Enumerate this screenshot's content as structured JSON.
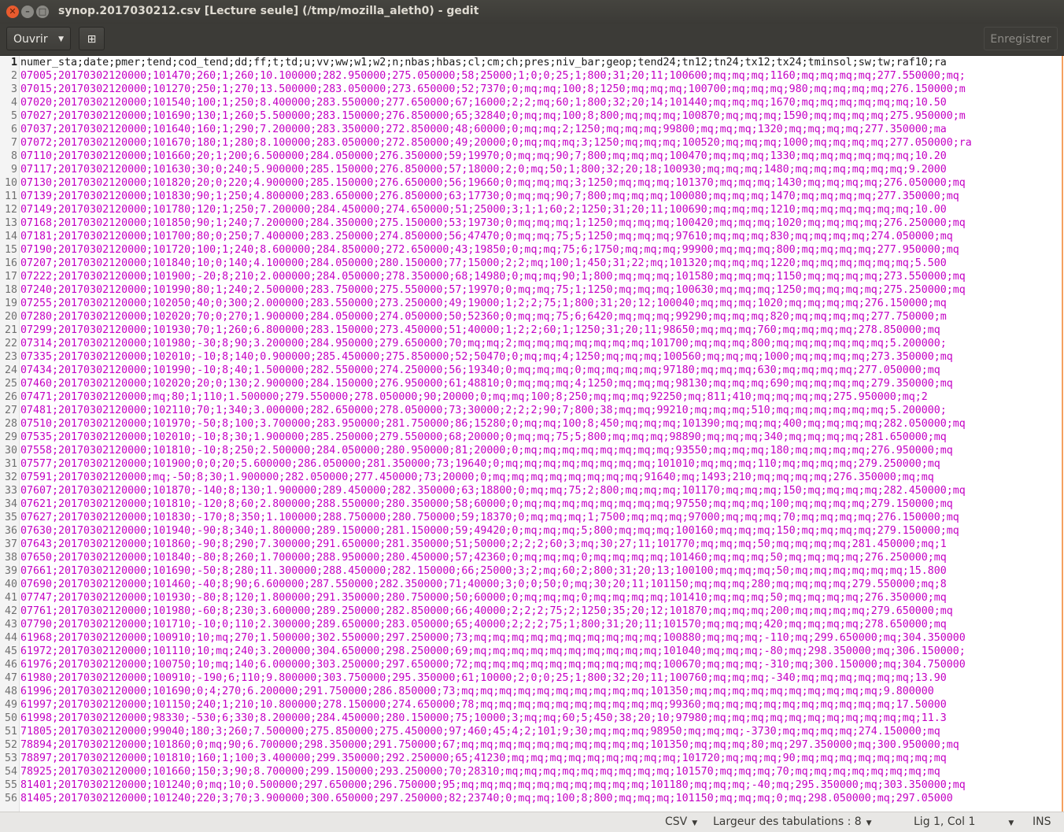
{
  "window": {
    "title": "synop.2017030212.csv [Lecture seule] (/tmp/mozilla_aleth0) - gedit",
    "close_glyph": "✕",
    "min_glyph": "–",
    "max_glyph": "□"
  },
  "toolbar": {
    "open_label": "Ouvrir",
    "new_tab_glyph": "⊞",
    "save_label": "Enregistrer"
  },
  "editor": {
    "lines": [
      "numer_sta;date;pmer;tend;cod_tend;dd;ff;t;td;u;vv;ww;w1;w2;n;nbas;hbas;cl;cm;ch;pres;niv_bar;geop;tend24;tn12;tn24;tx12;tx24;tminsol;sw;tw;raf10;ra",
      "07005;20170302120000;101470;260;1;260;10.100000;282.950000;275.050000;58;25000;1;0;0;25;1;800;31;20;11;100600;mq;mq;mq;1160;mq;mq;mq;mq;277.550000;mq;",
      "07015;20170302120000;101270;250;1;270;13.500000;283.050000;273.650000;52;7370;0;mq;mq;100;8;1250;mq;mq;mq;100700;mq;mq;mq;980;mq;mq;mq;mq;276.150000;m",
      "07020;20170302120000;101540;100;1;250;8.400000;283.550000;277.650000;67;16000;2;2;mq;60;1;800;32;20;14;101440;mq;mq;mq;1670;mq;mq;mq;mq;mq;mq;10.50",
      "07027;20170302120000;101690;130;1;260;5.500000;283.150000;276.850000;65;32840;0;mq;mq;100;8;800;mq;mq;mq;100870;mq;mq;mq;1590;mq;mq;mq;mq;275.950000;m",
      "07037;20170302120000;101640;160;1;290;7.200000;283.350000;272.850000;48;60000;0;mq;mq;2;1250;mq;mq;mq;99800;mq;mq;mq;1320;mq;mq;mq;mq;277.350000;ma",
      "07072;20170302120000;101670;180;1;280;8.100000;283.050000;272.850000;49;20000;0;mq;mq;mq;3;1250;mq;mq;mq;100520;mq;mq;mq;1000;mq;mq;mq;mq;277.050000;ra",
      "07110;20170302120000;101660;20;1;200;6.500000;284.050000;276.350000;59;19970;0;mq;mq;90;7;800;mq;mq;mq;100470;mq;mq;mq;1330;mq;mq;mq;mq;mq;mq;10.20",
      "07117;20170302120000;101630;30;0;240;5.900000;285.150000;276.850000;57;18000;2;0;mq;50;1;800;32;20;18;100930;mq;mq;mq;1480;mq;mq;mq;mq;mq;mq;9.2000",
      "07130;20170302120000;101820;20;0;220;4.900000;285.150000;276.650000;56;19660;0;mq;mq;mq;3;1250;mq;mq;mq;101370;mq;mq;mq;1430;mq;mq;mq;mq;276.050000;mq",
      "07139;20170302120000;101830;90;1;250;4.800000;283.650000;276.850000;63;17730;0;mq;mq;90;7;800;mq;mq;mq;100080;mq;mq;mq;1470;mq;mq;mq;mq;277.350000;mq",
      "07149;20170302120000;101780;120;1;250;7.200000;284.450000;274.650000;51;25000;3;1;1;60;2;1250;31;20;11;100690;mq;mq;mq;1210;mq;mq;mq;mq;mq;mq;10.00",
      "07168;20170302120000;101850;90;1;240;7.200000;284.350000;275.150000;53;19730;0;mq;mq;mq;1;1250;mq;mq;mq;100420;mq;mq;mq;1020;mq;mq;mq;mq;276.250000;mq",
      "07181;20170302120000;101700;80;0;250;7.400000;283.250000;274.850000;56;47470;0;mq;mq;75;5;1250;mq;mq;mq;97610;mq;mq;mq;830;mq;mq;mq;mq;274.050000;mq",
      "07190;20170302120000;101720;100;1;240;8.600000;284.850000;272.650000;43;19850;0;mq;mq;75;6;1750;mq;mq;mq;99900;mq;mq;mq;800;mq;mq;mq;mq;277.950000;mq",
      "07207;20170302120000;101840;10;0;140;4.100000;284.050000;280.150000;77;15000;2;2;mq;100;1;450;31;22;mq;101320;mq;mq;mq;1220;mq;mq;mq;mq;mq;mq;5.500",
      "07222;20170302120000;101900;-20;8;210;2.000000;284.050000;278.350000;68;14980;0;mq;mq;90;1;800;mq;mq;mq;101580;mq;mq;mq;1150;mq;mq;mq;mq;273.550000;mq",
      "07240;20170302120000;101990;80;1;240;2.500000;283.750000;275.550000;57;19970;0;mq;mq;75;1;1250;mq;mq;mq;100630;mq;mq;mq;1250;mq;mq;mq;mq;275.250000;mq",
      "07255;20170302120000;102050;40;0;300;2.000000;283.550000;273.250000;49;19000;1;2;2;75;1;800;31;20;12;100040;mq;mq;mq;1020;mq;mq;mq;mq;276.150000;mq",
      "07280;20170302120000;102020;70;0;270;1.900000;284.050000;274.050000;50;52360;0;mq;mq;75;6;6420;mq;mq;mq;99290;mq;mq;mq;820;mq;mq;mq;mq;277.750000;m",
      "07299;20170302120000;101930;70;1;260;6.800000;283.150000;273.450000;51;40000;1;2;2;60;1;1250;31;20;11;98650;mq;mq;mq;760;mq;mq;mq;mq;278.850000;mq",
      "07314;20170302120000;101980;-30;8;90;3.200000;284.950000;279.650000;70;mq;mq;2;mq;mq;mq;mq;mq;mq;mq;101700;mq;mq;mq;800;mq;mq;mq;mq;mq;mq;5.200000;",
      "07335;20170302120000;102010;-10;8;140;0.900000;285.450000;275.850000;52;50470;0;mq;mq;4;1250;mq;mq;mq;100560;mq;mq;mq;1000;mq;mq;mq;mq;273.350000;mq",
      "07434;20170302120000;101990;-10;8;40;1.500000;282.550000;274.250000;56;19340;0;mq;mq;mq;0;mq;mq;mq;mq;97180;mq;mq;mq;630;mq;mq;mq;mq;277.050000;mq",
      "07460;20170302120000;102020;20;0;130;2.900000;284.150000;276.950000;61;48810;0;mq;mq;mq;4;1250;mq;mq;mq;98130;mq;mq;mq;690;mq;mq;mq;mq;279.350000;mq",
      "07471;20170302120000;mq;80;1;110;1.500000;279.550000;278.050000;90;20000;0;mq;mq;100;8;250;mq;mq;mq;92250;mq;811;410;mq;mq;mq;mq;275.950000;mq;2",
      "07481;20170302120000;102110;70;1;340;3.000000;282.650000;278.050000;73;30000;2;2;2;90;7;800;38;mq;mq;99210;mq;mq;mq;510;mq;mq;mq;mq;mq;mq;5.200000;",
      "07510;20170302120000;101970;-50;8;100;3.700000;283.950000;281.750000;86;15280;0;mq;mq;100;8;450;mq;mq;mq;101390;mq;mq;mq;400;mq;mq;mq;mq;282.050000;mq",
      "07535;20170302120000;102010;-10;8;30;1.900000;285.250000;279.550000;68;20000;0;mq;mq;75;5;800;mq;mq;mq;98890;mq;mq;mq;340;mq;mq;mq;mq;281.650000;mq",
      "07558;20170302120000;101810;-10;8;250;2.500000;284.050000;280.950000;81;20000;0;mq;mq;mq;mq;mq;mq;mq;mq;93550;mq;mq;mq;180;mq;mq;mq;mq;276.950000;mq",
      "07577;20170302120000;101900;0;0;20;5.600000;286.050000;281.350000;73;19640;0;mq;mq;mq;mq;mq;mq;mq;mq;101010;mq;mq;mq;110;mq;mq;mq;mq;279.250000;mq",
      "07591;20170302120000;mq;-50;8;30;1.900000;282.050000;277.450000;73;20000;0;mq;mq;mq;mq;mq;mq;mq;mq;91640;mq;1493;210;mq;mq;mq;mq;276.350000;mq;mq",
      "07607;20170302120000;101870;-140;8;130;1.900000;289.450000;282.350000;63;18800;0;mq;mq;75;2;800;mq;mq;mq;101170;mq;mq;mq;150;mq;mq;mq;mq;282.450000;mq",
      "07621;20170302120000;101810;-120;8;60;2.800000;288.550000;280.350000;58;60000;0;mq;mq;mq;mq;mq;mq;mq;mq;97550;mq;mq;mq;100;mq;mq;mq;mq;279.150000;mq",
      "07627;20170302120000;101830;-170;8;350;1.100000;288.750000;280.750000;59;18370;0;mq;mq;mq;1;7500;mq;mq;mq;97000;mq;mq;mq;70;mq;mq;mq;mq;276.150000;mq",
      "07630;20170302120000;101940;-90;8;340;1.800000;289.150000;281.150000;59;49420;0;mq;mq;mq;5;800;mq;mq;mq;100160;mq;mq;mq;150;mq;mq;mq;mq;279.150000;mq",
      "07643;20170302120000;101860;-90;8;290;7.300000;291.650000;281.350000;51;50000;2;2;2;60;3;mq;30;27;11;101770;mq;mq;mq;50;mq;mq;mq;mq;281.450000;mq;1",
      "07650;20170302120000;101840;-80;8;260;1.700000;288.950000;280.450000;57;42360;0;mq;mq;mq;0;mq;mq;mq;mq;101460;mq;mq;mq;50;mq;mq;mq;mq;276.250000;mq",
      "07661;20170302120000;101690;-50;8;280;11.300000;288.450000;282.150000;66;25000;3;2;mq;60;2;800;31;20;13;100100;mq;mq;mq;50;mq;mq;mq;mq;mq;mq;15.800",
      "07690;20170302120000;101460;-40;8;90;6.600000;287.550000;282.350000;71;40000;3;0;0;50;0;mq;30;20;11;101150;mq;mq;mq;280;mq;mq;mq;mq;279.550000;mq;8",
      "07747;20170302120000;101930;-80;8;120;1.800000;291.350000;280.750000;50;60000;0;mq;mq;mq;0;mq;mq;mq;mq;101410;mq;mq;mq;50;mq;mq;mq;mq;276.350000;mq",
      "07761;20170302120000;101980;-60;8;230;3.600000;289.250000;282.850000;66;40000;2;2;2;75;2;1250;35;20;12;101870;mq;mq;mq;200;mq;mq;mq;mq;279.650000;mq",
      "07790;20170302120000;101710;-10;0;110;2.300000;289.650000;283.050000;65;40000;2;2;2;75;1;800;31;20;11;101570;mq;mq;mq;420;mq;mq;mq;mq;278.650000;mq",
      "61968;20170302120000;100910;10;mq;270;1.500000;302.550000;297.250000;73;mq;mq;mq;mq;mq;mq;mq;mq;mq;mq;100880;mq;mq;mq;-110;mq;299.650000;mq;304.350000",
      "61972;20170302120000;101110;10;mq;240;3.200000;304.650000;298.250000;69;mq;mq;mq;mq;mq;mq;mq;mq;mq;mq;101040;mq;mq;mq;-80;mq;298.350000;mq;306.150000;",
      "61976;20170302120000;100750;10;mq;140;6.000000;303.250000;297.650000;72;mq;mq;mq;mq;mq;mq;mq;mq;mq;mq;100670;mq;mq;mq;-310;mq;300.150000;mq;304.750000",
      "61980;20170302120000;100910;-190;6;110;9.800000;303.750000;295.350000;61;10000;2;0;0;25;1;800;32;20;11;100760;mq;mq;mq;-340;mq;mq;mq;mq;mq;mq;13.90",
      "61996;20170302120000;101690;0;4;270;6.200000;291.750000;286.850000;73;mq;mq;mq;mq;mq;mq;mq;mq;mq;mq;101350;mq;mq;mq;mq;mq;mq;mq;mq;mq;mq;9.800000",
      "61997;20170302120000;101150;240;1;210;10.800000;278.150000;274.650000;78;mq;mq;mq;mq;mq;mq;mq;mq;mq;mq;99360;mq;mq;mq;mq;mq;mq;mq;mq;mq;mq;17.50000",
      "61998;20170302120000;98330;-530;6;330;8.200000;284.450000;280.150000;75;10000;3;mq;mq;60;5;450;38;20;10;97980;mq;mq;mq;mq;mq;mq;mq;mq;mq;mq;mq;11.3",
      "71805;20170302120000;99040;180;3;260;7.500000;275.850000;275.450000;97;460;45;4;2;101;9;30;mq;mq;mq;98950;mq;mq;mq;-3730;mq;mq;mq;mq;274.150000;mq",
      "78894;20170302120000;101860;0;mq;90;6.700000;298.350000;291.750000;67;mq;mq;mq;mq;mq;mq;mq;mq;mq;mq;101350;mq;mq;mq;80;mq;297.350000;mq;300.950000;mq",
      "78897;20170302120000;101810;160;1;100;3.400000;299.350000;292.250000;65;41230;mq;mq;mq;mq;mq;mq;mq;mq;mq;101720;mq;mq;mq;90;mq;mq;mq;mq;mq;mq;mq;mq",
      "78925;20170302120000;101660;150;3;90;8.700000;299.150000;293.250000;70;28310;mq;mq;mq;mq;mq;mq;mq;mq;mq;101570;mq;mq;mq;70;mq;mq;mq;mq;mq;mq;mq;mq",
      "81401;20170302120000;101240;0;mq;10;0.500000;297.650000;296.750000;95;mq;mq;mq;mq;mq;mq;mq;mq;mq;mq;101180;mq;mq;mq;-40;mq;295.350000;mq;303.350000;mq",
      "81405;20170302120000;101240;220;3;70;3.900000;300.650000;297.250000;82;23740;0;mq;mq;100;8;800;mq;mq;mq;101150;mq;mq;mq;0;mq;298.050000;mq;297.05000"
    ]
  },
  "statusbar": {
    "language": "CSV",
    "tab_width": "Largeur des tabulations : 8",
    "position": "Lig 1, Col 1",
    "mode": "INS"
  }
}
